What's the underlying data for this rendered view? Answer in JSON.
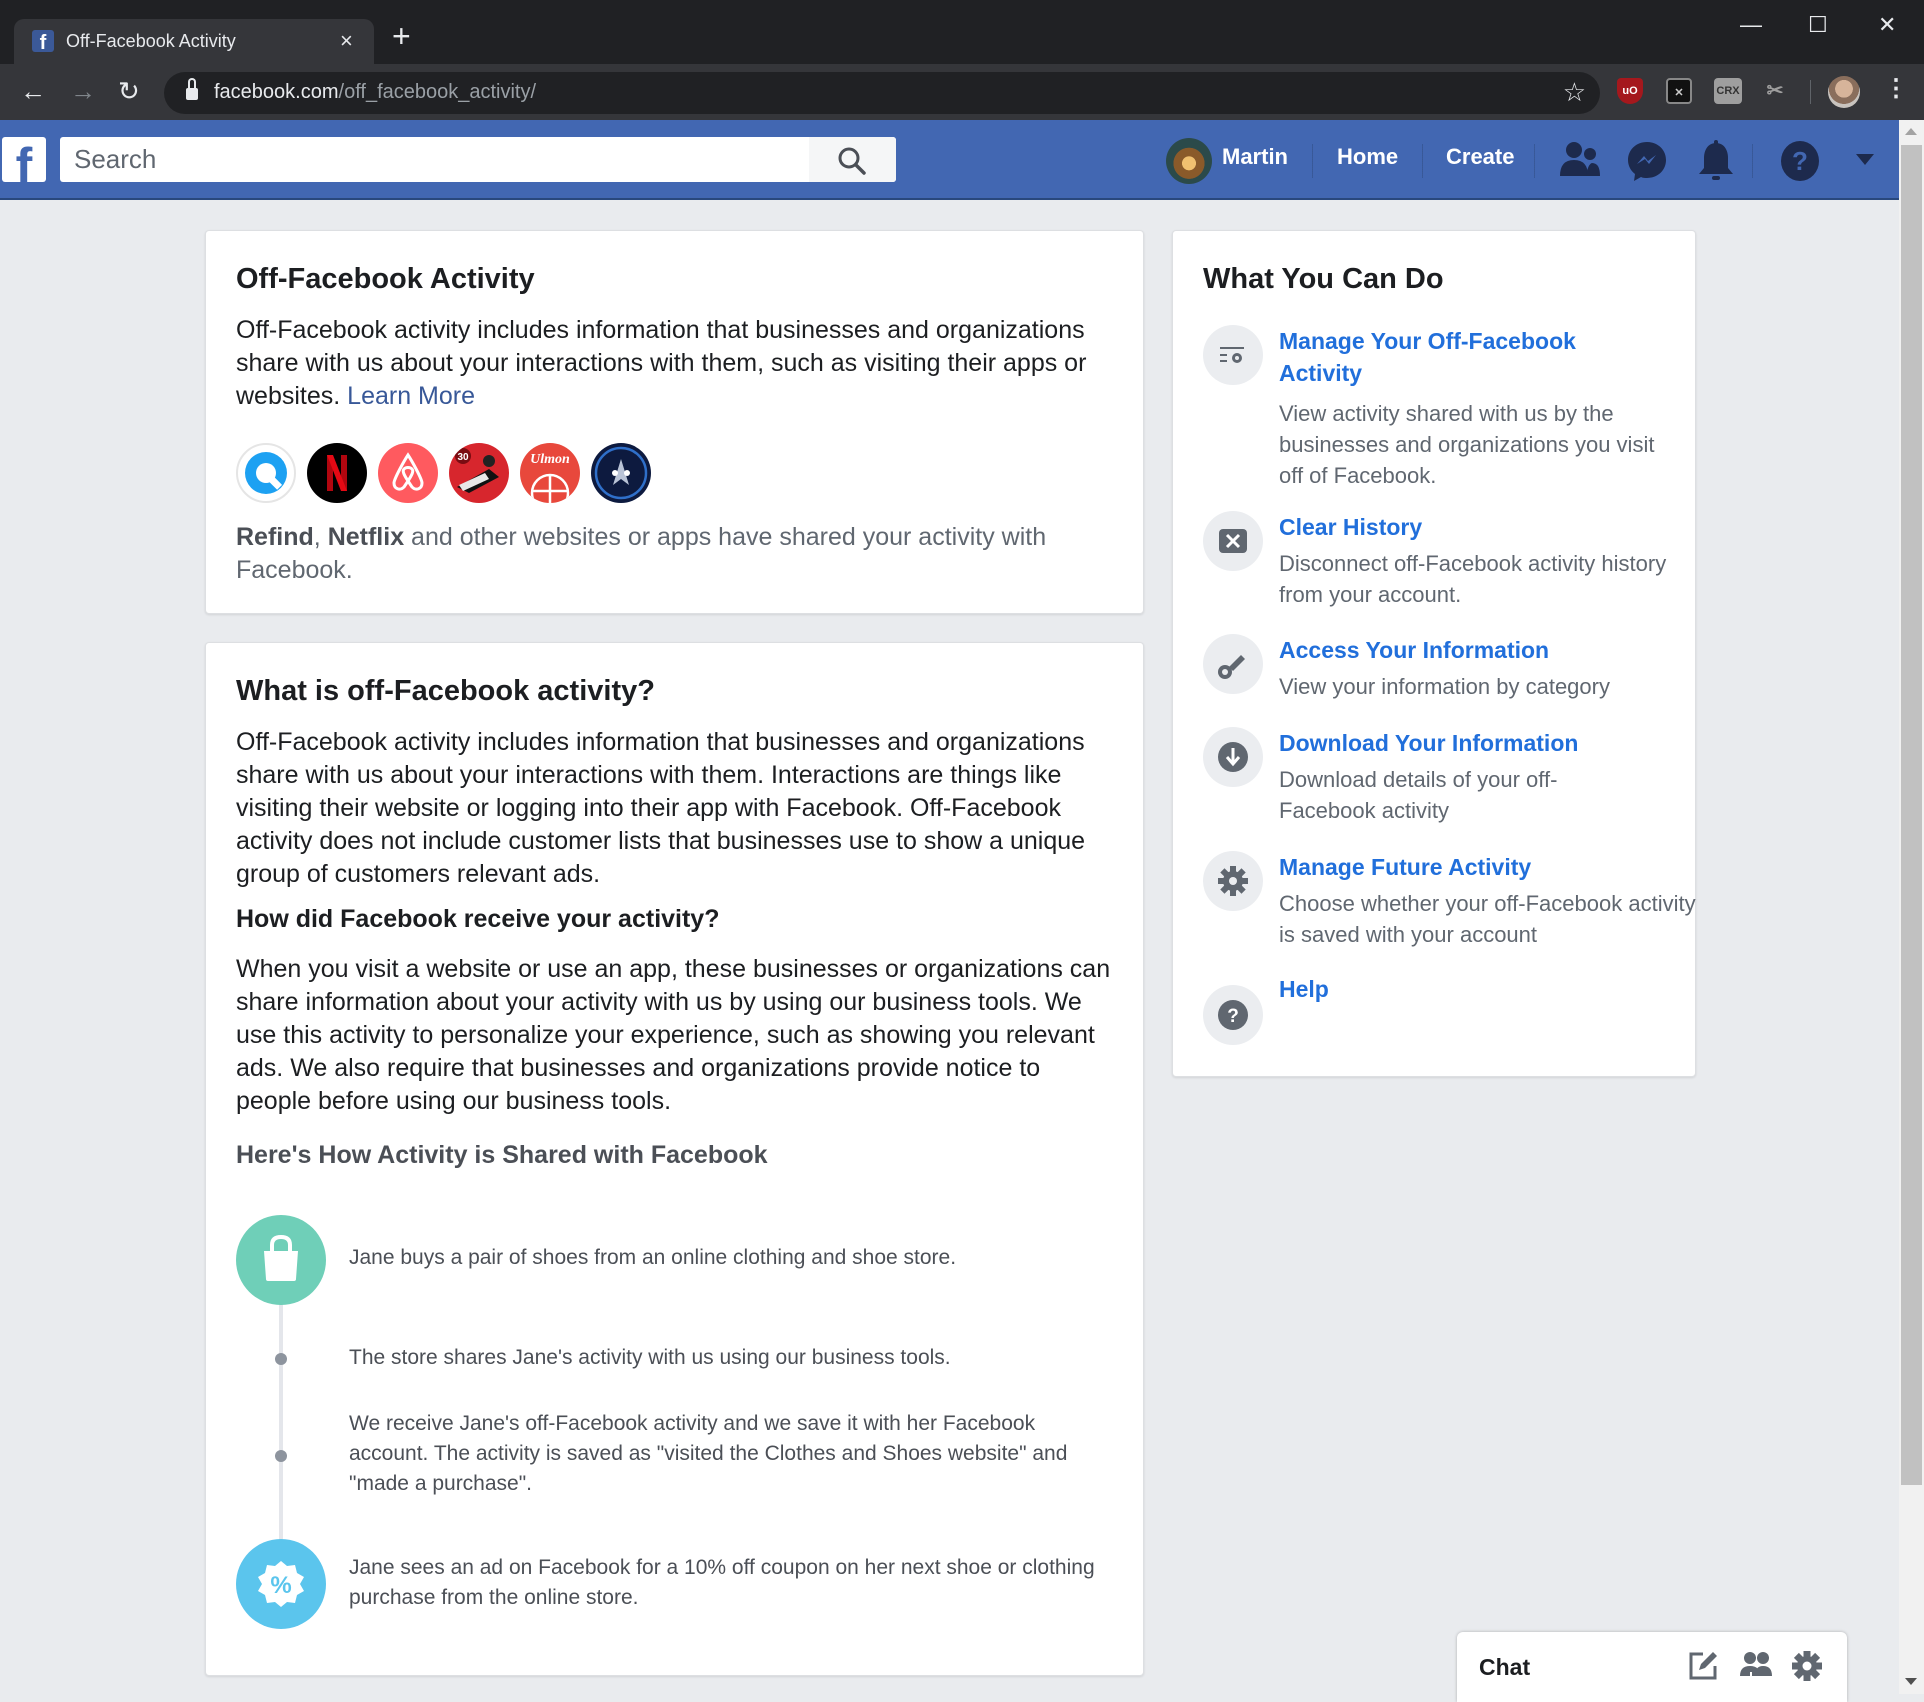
{
  "browser": {
    "tab_title": "Off-Facebook Activity",
    "tab_close": "×",
    "new_tab": "+",
    "url_host": "facebook.com",
    "url_path": "/off_facebook_activity/",
    "window_controls": {
      "minimize": "—",
      "maximize": "☐",
      "close": "✕"
    },
    "extensions": [
      "uBlock Origin",
      "Cookie AutoDelete",
      "CRX",
      "Scissors"
    ],
    "ext_crx_label": "CRX",
    "ext_ublock_label": "uO",
    "menu": "⋮"
  },
  "fb_header": {
    "logo": "f",
    "search_placeholder": "Search",
    "user_name": "Martin",
    "nav": [
      "Home",
      "Create"
    ],
    "icons": [
      "friends-icon",
      "messenger-icon",
      "notifications-icon",
      "help-icon",
      "account-menu-icon"
    ]
  },
  "intro_card": {
    "title": "Off-Facebook Activity",
    "description": "Off-Facebook activity includes information that businesses and organizations share with us about your interactions with them, such as visiting their apps or websites.",
    "learn_more": "Learn More",
    "apps": [
      {
        "name": "Refind",
        "bg": "#ffffff",
        "fg": "#1da1f2"
      },
      {
        "name": "Netflix",
        "bg": "#000000",
        "fg": "#e50914"
      },
      {
        "name": "Airbnb",
        "bg": "#ff5a5f",
        "fg": "#ffffff"
      },
      {
        "name": "30 Day Fitness",
        "bg": "#d7262d",
        "fg": "#ffffff"
      },
      {
        "name": "Ulmon",
        "bg": "#e8483c",
        "fg": "#ffffff"
      },
      {
        "name": "Star app",
        "bg": "#0d1a3f",
        "fg": "#4a90e2"
      }
    ],
    "shared_by_1": "Refind",
    "shared_sep": ", ",
    "shared_by_2": "Netflix",
    "shared_rest": " and other websites or apps have shared your activity with Facebook."
  },
  "what_card": {
    "title": "What is off-Facebook activity?",
    "p1": "Off-Facebook activity includes information that businesses and organizations share with us about your interactions with them. Interactions are things like visiting their website or logging into their app with Facebook. Off-Facebook activity does not include customer lists that businesses use to show a unique group of customers relevant ads.",
    "subtitle": "How did Facebook receive your activity?",
    "p2": "When you visit a website or use an app, these businesses or organizations can share information about your activity with us by using our business tools. We use this activity to personalize your experience, such as showing you relevant ads. We also require that businesses and organizations provide notice to people before using our business tools.",
    "timeline_title": "Here's How Activity is Shared with Facebook",
    "timeline": [
      {
        "text": "Jane buys a pair of shoes from an online clothing and shoe store.",
        "icon": "shopping-bag-icon",
        "color": "#6fcfb8"
      },
      {
        "text": "The store shares Jane's activity with us using our business tools.",
        "icon": "dot"
      },
      {
        "text": "We receive Jane's off-Facebook activity and we save it with her Facebook account. The activity is saved as \"visited the Clothes and Shoes website\" and \"made a purchase\".",
        "icon": "dot"
      },
      {
        "text": "Jane sees an ad on Facebook for a 10% off coupon on her next shoe or clothing purchase from the online store.",
        "icon": "percent-badge-icon",
        "color": "#5bc5ed"
      }
    ]
  },
  "actions_card": {
    "title": "What You Can Do",
    "items": [
      {
        "title": "Manage Your Off-Facebook Activity",
        "desc": "View activity shared with us by the businesses and organizations you visit off of Facebook.",
        "icon": "manage-activity-icon"
      },
      {
        "title": "Clear History",
        "desc": "Disconnect off-Facebook activity history from your account.",
        "icon": "clear-icon"
      },
      {
        "title": "Access Your Information",
        "desc": "View your information by category",
        "icon": "key-icon"
      },
      {
        "title": "Download Your Information",
        "desc": "Download details of your off-Facebook activity",
        "icon": "download-icon"
      },
      {
        "title": "Manage Future Activity",
        "desc": "Choose whether your off-Facebook activity is saved with your account",
        "icon": "gear-icon"
      },
      {
        "title": "Help",
        "desc": "",
        "icon": "help-icon"
      }
    ]
  },
  "chat": {
    "label": "Chat"
  },
  "colors": {
    "fb_blue": "#4267b2",
    "link_blue": "#385898",
    "action_link_blue": "#216fdb",
    "background": "#e9ebee"
  }
}
